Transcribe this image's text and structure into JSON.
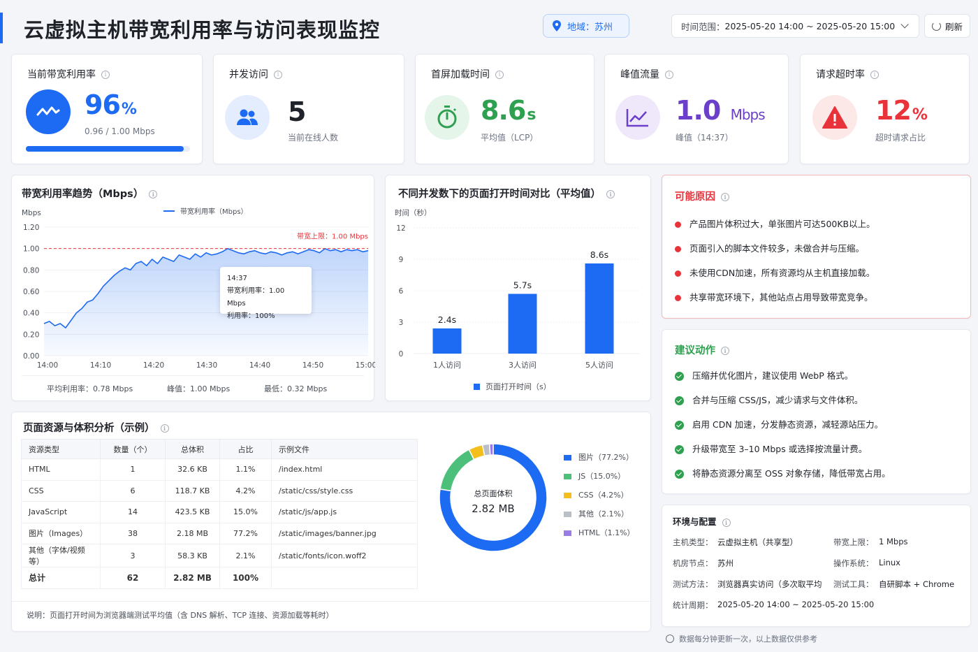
{
  "header": {
    "title": "云虚拟主机带宽利用率与访问表现监控",
    "region_label": "地域：",
    "region_value": "苏州",
    "time_label": "时间范围：",
    "time_value": "2025-05-20 14:00 ~ 2025-05-20 15:00",
    "refresh_label": "刷新",
    "accent_color": "#1d6bf3"
  },
  "kpis": [
    {
      "title": "当前带宽利用率",
      "value": "96",
      "unit": "%",
      "sub": "0.96 / 1.00 Mbps",
      "progress": 0.96,
      "color": "#1d6bf3",
      "icon": "line-chart-icon"
    },
    {
      "title": "并发访问",
      "value": "5",
      "unit": "",
      "sub": "当前在线人数",
      "color": "#1f2329",
      "icon": "users-icon"
    },
    {
      "title": "首屏加载时间",
      "value": "8.6",
      "unit": "s",
      "sub": "平均值（LCP）",
      "color": "#2ea04f",
      "icon": "stopwatch-icon"
    },
    {
      "title": "峰值流量",
      "value": "1.0",
      "unit": "Mbps",
      "sub": "峰值（14:37）",
      "color": "#6a3fc9",
      "icon": "trend-chart-icon"
    },
    {
      "title": "请求超时率",
      "value": "12",
      "unit": "%",
      "sub": "超时请求占比",
      "color": "#e8333a",
      "icon": "warning-icon"
    }
  ],
  "bandwidth_chart": {
    "title": "带宽利用率趋势（Mbps）",
    "unit_label": "Mbps",
    "legend": "带宽利用率（Mbps）",
    "limit_label": "带宽上限：1.00 Mbps",
    "tooltip": {
      "time": "14:37",
      "line1": "带宽利用率：1.00 Mbps",
      "line2": "利用率：100%"
    },
    "footer": {
      "avg": "平均利用率：0.78 Mbps",
      "peak": "峰值：1.00 Mbps",
      "min": "最低：0.32 Mbps"
    }
  },
  "load_chart": {
    "title": "不同并发数下的页面打开时间对比（平均值）",
    "unit_label": "时间（秒）",
    "legend": "页面打开时间（s）"
  },
  "chart_data": [
    {
      "type": "area",
      "title": "带宽利用率趋势（Mbps）",
      "ylabel": "Mbps",
      "ylim": [
        0,
        1.2
      ],
      "yticks": [
        "0.00",
        "0.20",
        "0.40",
        "0.60",
        "0.80",
        "1.00",
        "1.20"
      ],
      "xticks": [
        "14:00",
        "14:10",
        "14:20",
        "14:30",
        "14:40",
        "14:50",
        "15:00"
      ],
      "threshold": 1.0,
      "series": [
        {
          "name": "带宽利用率（Mbps）",
          "color": "#1d6bf3",
          "points": [
            [
              0,
              0.3
            ],
            [
              1,
              0.32
            ],
            [
              2,
              0.28
            ],
            [
              3,
              0.3
            ],
            [
              4,
              0.26
            ],
            [
              5,
              0.33
            ],
            [
              6,
              0.4
            ],
            [
              7,
              0.44
            ],
            [
              8,
              0.5
            ],
            [
              9,
              0.52
            ],
            [
              10,
              0.58
            ],
            [
              11,
              0.65
            ],
            [
              12,
              0.7
            ],
            [
              13,
              0.75
            ],
            [
              14,
              0.79
            ],
            [
              15,
              0.82
            ],
            [
              16,
              0.8
            ],
            [
              17,
              0.86
            ],
            [
              18,
              0.88
            ],
            [
              19,
              0.84
            ],
            [
              20,
              0.9
            ],
            [
              21,
              0.86
            ],
            [
              22,
              0.92
            ],
            [
              23,
              0.9
            ],
            [
              24,
              0.88
            ],
            [
              25,
              0.94
            ],
            [
              26,
              0.92
            ],
            [
              27,
              0.9
            ],
            [
              28,
              0.95
            ],
            [
              29,
              0.92
            ],
            [
              30,
              0.96
            ],
            [
              31,
              0.94
            ],
            [
              32,
              0.95
            ],
            [
              33,
              0.97
            ],
            [
              34,
              1.0
            ],
            [
              35,
              0.98
            ],
            [
              36,
              0.96
            ],
            [
              37,
              0.95
            ],
            [
              38,
              0.97
            ],
            [
              39,
              0.98
            ],
            [
              40,
              0.96
            ],
            [
              41,
              0.95
            ],
            [
              42,
              0.97
            ],
            [
              43,
              0.96
            ],
            [
              44,
              0.94
            ],
            [
              45,
              0.96
            ],
            [
              46,
              0.97
            ],
            [
              47,
              0.95
            ],
            [
              48,
              0.97
            ],
            [
              49,
              0.99
            ],
            [
              50,
              0.98
            ],
            [
              51,
              0.96
            ],
            [
              52,
              1.0
            ],
            [
              53,
              0.98
            ],
            [
              54,
              0.99
            ],
            [
              55,
              0.97
            ],
            [
              56,
              0.99
            ],
            [
              57,
              0.98
            ],
            [
              58,
              0.99
            ],
            [
              59,
              0.97
            ],
            [
              60,
              0.98
            ]
          ]
        }
      ]
    },
    {
      "type": "bar",
      "title": "不同并发数下的页面打开时间对比（平均值）",
      "ylabel": "时间（秒）",
      "ylim": [
        0,
        12
      ],
      "yticks": [
        "0",
        "3",
        "6",
        "9",
        "12"
      ],
      "categories": [
        "1人访问",
        "3人访问",
        "5人访问"
      ],
      "values": [
        2.4,
        5.7,
        8.6
      ],
      "labels": [
        "2.4s",
        "5.7s",
        "8.6s"
      ],
      "series": [
        {
          "name": "页面打开时间（s）",
          "values": [
            2.4,
            5.7,
            8.6
          ],
          "color": "#1d6bf3"
        }
      ]
    },
    {
      "type": "pie",
      "title": "",
      "center_label": "总页面体积",
      "center_value": "2.82 MB",
      "slices": [
        {
          "label": "图片（77.2%）",
          "value": 77.2,
          "color": "#1d6bf3"
        },
        {
          "label": "JS（15.0%）",
          "value": 15.0,
          "color": "#4cbf7a"
        },
        {
          "label": "CSS（4.2%）",
          "value": 4.2,
          "color": "#f4bf1c"
        },
        {
          "label": "其他（2.1%）",
          "value": 2.1,
          "color": "#b9bec7"
        },
        {
          "label": "HTML（1.1%）",
          "value": 1.1,
          "color": "#9b7be8"
        }
      ]
    }
  ],
  "resources": {
    "title": "页面资源与体积分析（示例）",
    "headers": [
      "资源类型",
      "数量（个）",
      "总体积",
      "占比",
      "示例文件"
    ],
    "rows": [
      [
        "HTML",
        "1",
        "32.6 KB",
        "1.1%",
        "/index.html"
      ],
      [
        "CSS",
        "6",
        "118.7 KB",
        "4.2%",
        "/static/css/style.css"
      ],
      [
        "JavaScript",
        "14",
        "423.5 KB",
        "15.0%",
        "/static/js/app.js"
      ],
      [
        "图片（Images）",
        "38",
        "2.18 MB",
        "77.2%",
        "/static/images/banner.jpg"
      ],
      [
        "其他（字体/视频等）",
        "3",
        "58.3 KB",
        "2.1%",
        "/static/fonts/icon.woff2"
      ]
    ],
    "total": [
      "总计",
      "62",
      "2.82 MB",
      "100%",
      ""
    ],
    "note": "说明：页面打开时间为浏览器端测试平均值（含 DNS 解析、TCP 连接、资源加载等耗时）"
  },
  "causes": {
    "title": "可能原因",
    "items": [
      "产品图片体积过大，单张图片可达500KB以上。",
      "页面引入的脚本文件较多，未做合并与压缩。",
      "未使用CDN加速，所有资源均从主机直接加载。",
      "共享带宽环境下，其他站点占用导致带宽竞争。"
    ]
  },
  "actions": {
    "title": "建议动作",
    "items": [
      "压缩并优化图片，建议使用 WebP 格式。",
      "合并与压缩 CSS/JS，减少请求与文件体积。",
      "启用 CDN 加速，分发静态资源，减轻源站压力。",
      "升级带宽至 3–10 Mbps 或选择按流量计费。",
      "将静态资源分离至 OSS 对象存储，降低带宽占用。"
    ]
  },
  "env": {
    "title": "环境与配置",
    "host_type_label": "主机类型：",
    "host_type": "云虚拟主机（共享型）",
    "bw_label": "带宽上限：",
    "bw": "1 Mbps",
    "node_label": "机房节点：",
    "node": "苏州",
    "os_label": "操作系统：",
    "os": "Linux",
    "method_label": "测试方法：",
    "method": "浏览器真实访问（多次取平均",
    "tool_label": "测试工具：",
    "tool": "自研脚本 + Chrome",
    "period_label": "统计周期：",
    "period": "2025-05-20 14:00 ~ 2025-05-20 15:00"
  },
  "footer_note": "数据每分钟更新一次，以上数据仅供参考"
}
